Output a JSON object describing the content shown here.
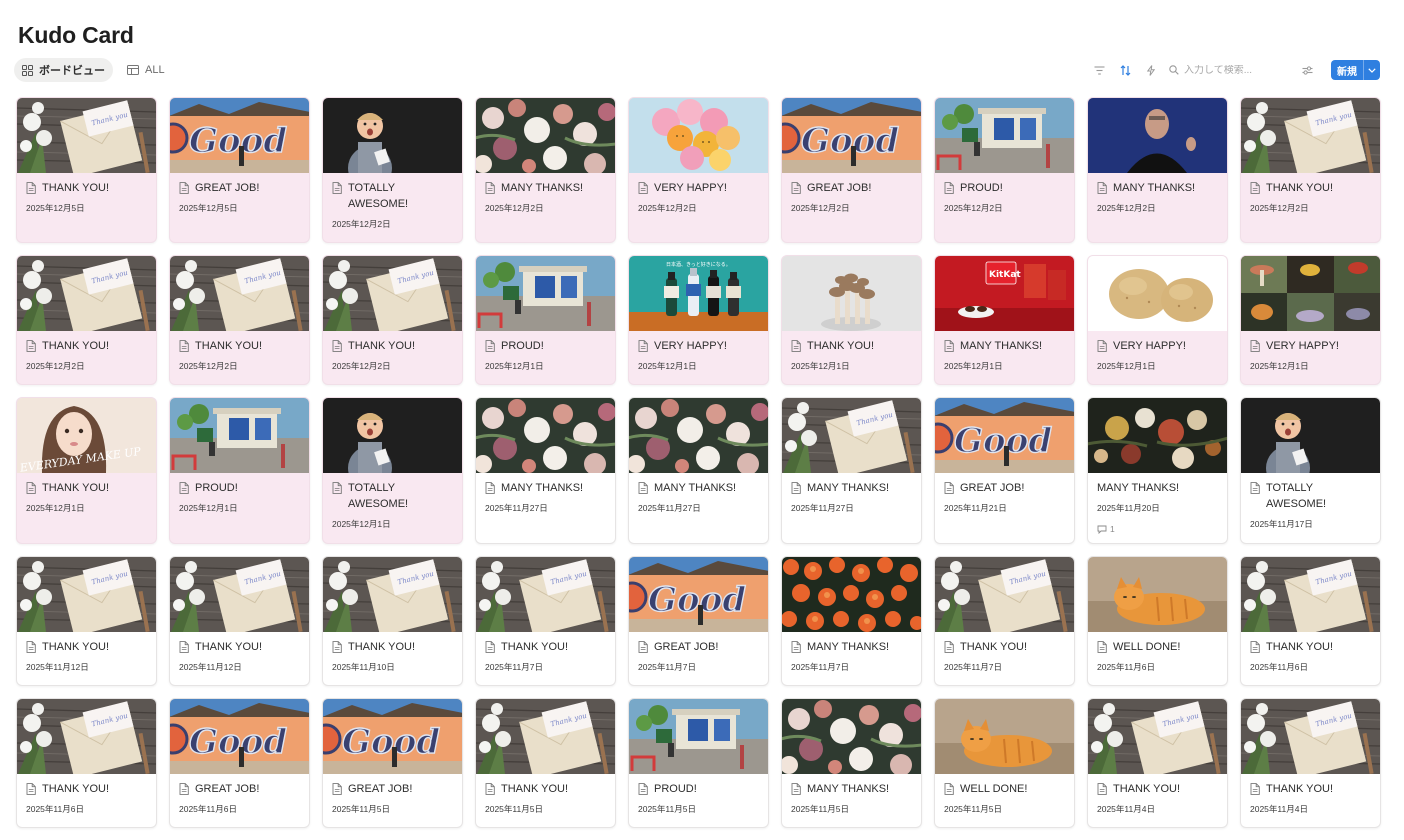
{
  "title": "Kudo Card",
  "views": [
    {
      "label": "ボードビュー",
      "icon": "board-icon",
      "active": true
    },
    {
      "label": "ALL",
      "icon": "table-icon",
      "active": false
    }
  ],
  "toolbar": {
    "search_placeholder": "入力して検索...",
    "new_label": "新規",
    "accent": "#2f7fe0"
  },
  "card_colors": {
    "pink": "#f9e8f1",
    "white": "#ffffff"
  },
  "cards": [
    {
      "title": "THANK YOU!",
      "date": "2025年12月5日",
      "image": "letter-flowers",
      "pink": true
    },
    {
      "title": "GREAT JOB!",
      "date": "2025年12月5日",
      "image": "good-mural",
      "pink": true
    },
    {
      "title": "TOTALLY AWESOME!",
      "date": "2025年12月2日",
      "image": "kid-surprised",
      "pink": true
    },
    {
      "title": "MANY THANKS!",
      "date": "2025年12月2日",
      "image": "flower-bouquet",
      "pink": true
    },
    {
      "title": "VERY HAPPY!",
      "date": "2025年12月2日",
      "image": "balloons",
      "pink": true
    },
    {
      "title": "GREAT JOB!",
      "date": "2025年12月2日",
      "image": "good-mural",
      "pink": true
    },
    {
      "title": "PROUD!",
      "date": "2025年12月2日",
      "image": "street-shop",
      "pink": true
    },
    {
      "title": "MANY THANKS!",
      "date": "2025年12月2日",
      "image": "speaker-portrait",
      "pink": true
    },
    {
      "title": "THANK YOU!",
      "date": "2025年12月2日",
      "image": "letter-flowers",
      "pink": true
    },
    {
      "title": "THANK YOU!",
      "date": "2025年12月2日",
      "image": "letter-flowers",
      "pink": true
    },
    {
      "title": "THANK YOU!",
      "date": "2025年12月2日",
      "image": "letter-flowers",
      "pink": true
    },
    {
      "title": "THANK YOU!",
      "date": "2025年12月2日",
      "image": "letter-flowers",
      "pink": true
    },
    {
      "title": "PROUD!",
      "date": "2025年12月1日",
      "image": "street-shop",
      "pink": true
    },
    {
      "title": "VERY HAPPY!",
      "date": "2025年12月1日",
      "image": "sake-bottles",
      "pink": true
    },
    {
      "title": "THANK YOU!",
      "date": "2025年12月1日",
      "image": "mushrooms",
      "pink": true
    },
    {
      "title": "MANY THANKS!",
      "date": "2025年12月1日",
      "image": "red-snack",
      "pink": true
    },
    {
      "title": "VERY HAPPY!",
      "date": "2025年12月1日",
      "image": "potatoes",
      "pink": true
    },
    {
      "title": "VERY HAPPY!",
      "date": "2025年12月1日",
      "image": "mushroom-collage",
      "pink": true
    },
    {
      "title": "THANK YOU!",
      "date": "2025年12月1日",
      "image": "makeup-portrait",
      "pink": true
    },
    {
      "title": "PROUD!",
      "date": "2025年12月1日",
      "image": "street-shop",
      "pink": true
    },
    {
      "title": "TOTALLY AWESOME!",
      "date": "2025年12月1日",
      "image": "kid-surprised",
      "pink": true
    },
    {
      "title": "MANY THANKS!",
      "date": "2025年11月27日",
      "image": "flower-bouquet",
      "pink": false
    },
    {
      "title": "MANY THANKS!",
      "date": "2025年11月27日",
      "image": "flower-bouquet",
      "pink": false
    },
    {
      "title": "MANY THANKS!",
      "date": "2025年11月27日",
      "image": "letter-flowers",
      "pink": false
    },
    {
      "title": "GREAT JOB!",
      "date": "2025年11月21日",
      "image": "good-mural",
      "pink": false
    },
    {
      "title": "MANY THANKS!",
      "date": "2025年11月20日",
      "image": "dark-florals",
      "pink": false,
      "no_icon": true,
      "comments": "1"
    },
    {
      "title": "TOTALLY AWESOME!",
      "date": "2025年11月17日",
      "image": "kid-surprised",
      "pink": false
    },
    {
      "title": "THANK YOU!",
      "date": "2025年11月12日",
      "image": "letter-flowers",
      "pink": false
    },
    {
      "title": "THANK YOU!",
      "date": "2025年11月12日",
      "image": "letter-flowers",
      "pink": false
    },
    {
      "title": "THANK YOU!",
      "date": "2025年11月10日",
      "image": "letter-flowers",
      "pink": false
    },
    {
      "title": "THANK YOU!",
      "date": "2025年11月7日",
      "image": "letter-flowers",
      "pink": false
    },
    {
      "title": "GREAT JOB!",
      "date": "2025年11月7日",
      "image": "good-mural",
      "pink": false
    },
    {
      "title": "MANY THANKS!",
      "date": "2025年11月7日",
      "image": "orange-roses",
      "pink": false
    },
    {
      "title": "THANK YOU!",
      "date": "2025年11月7日",
      "image": "letter-flowers",
      "pink": false
    },
    {
      "title": "WELL DONE!",
      "date": "2025年11月6日",
      "image": "cat",
      "pink": false
    },
    {
      "title": "THANK YOU!",
      "date": "2025年11月6日",
      "image": "letter-flowers",
      "pink": false
    },
    {
      "title": "THANK YOU!",
      "date": "2025年11月6日",
      "image": "letter-flowers",
      "pink": false
    },
    {
      "title": "GREAT JOB!",
      "date": "2025年11月6日",
      "image": "good-mural",
      "pink": false
    },
    {
      "title": "GREAT JOB!",
      "date": "2025年11月5日",
      "image": "good-mural",
      "pink": false
    },
    {
      "title": "THANK YOU!",
      "date": "2025年11月5日",
      "image": "letter-flowers",
      "pink": false
    },
    {
      "title": "PROUD!",
      "date": "2025年11月5日",
      "image": "street-shop",
      "pink": false
    },
    {
      "title": "MANY THANKS!",
      "date": "2025年11月5日",
      "image": "flower-bouquet",
      "pink": false
    },
    {
      "title": "WELL DONE!",
      "date": "2025年11月5日",
      "image": "cat",
      "pink": false
    },
    {
      "title": "THANK YOU!",
      "date": "2025年11月4日",
      "image": "letter-flowers",
      "pink": false
    },
    {
      "title": "THANK YOU!",
      "date": "2025年11月4日",
      "image": "letter-flowers",
      "pink": false
    }
  ]
}
